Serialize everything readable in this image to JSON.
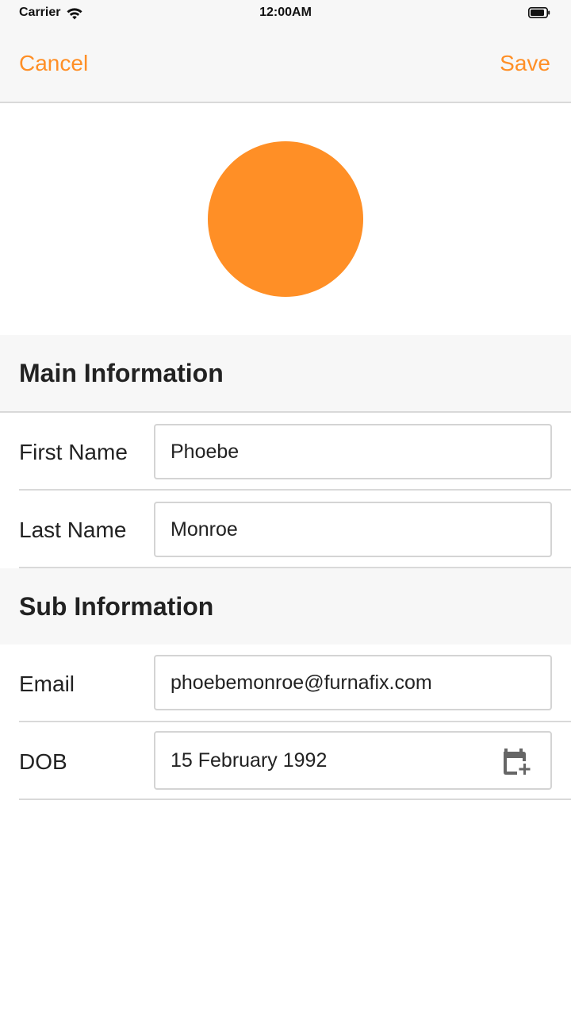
{
  "status_bar": {
    "carrier": "Carrier",
    "time": "12:00AM"
  },
  "nav": {
    "cancel_label": "Cancel",
    "save_label": "Save"
  },
  "colors": {
    "accent": "#ff8f26",
    "section_background": "#f7f7f7",
    "divider": "#d9d9d9"
  },
  "main_information": {
    "title": "Main Information",
    "first_name_label": "First Name",
    "first_name_value": "Phoebe",
    "last_name_label": "Last Name",
    "last_name_value": "Monroe"
  },
  "sub_information": {
    "title": "Sub Information",
    "email_label": "Email",
    "email_value": "phoebemonroe@furnafix.com",
    "dob_label": "DOB",
    "dob_value": "15 February 1992"
  },
  "icons": {
    "wifi": "wifi-icon",
    "battery": "battery-icon",
    "calendar": "calendar-add-icon"
  }
}
